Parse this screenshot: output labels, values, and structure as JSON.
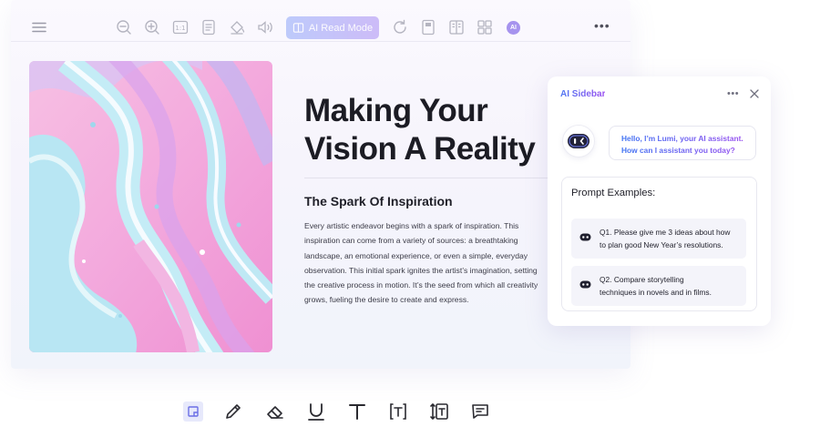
{
  "toolbar": {
    "items": [
      {
        "name": "menu-icon"
      },
      {
        "name": "zoom-out-icon"
      },
      {
        "name": "zoom-in-icon"
      },
      {
        "name": "actual-size-icon",
        "label": "1:1"
      },
      {
        "name": "page-layout-icon"
      },
      {
        "name": "fill-icon"
      },
      {
        "name": "speaker-icon"
      },
      {
        "name": "rotate-icon"
      },
      {
        "name": "single-page-icon"
      },
      {
        "name": "two-page-icon"
      },
      {
        "name": "grid-view-icon"
      },
      {
        "name": "more-icon"
      }
    ],
    "ai_read_mode_label": "AI Read Mode",
    "ai_badge_label": "AI"
  },
  "document": {
    "title_lines": [
      "Making Your",
      "Vision A Reality"
    ],
    "subtitle": "The Spark Of Inspiration",
    "body_lines": [
      "Every artistic endeavor begins with a spark of inspiration. This",
      "inspiration can come from a variety of sources: a breathtaking",
      "landscape, an emotional experience, or even a simple, everyday",
      "observation. This initial spark ignites the artist’s imagination, setting",
      "the creative process in motion. It’s the seed from which all creativity",
      "grows, fueling the desire to create and express."
    ],
    "hero_image": "abstract-pink-blue-fluid-art"
  },
  "ai_sidebar": {
    "title": "AI Sidebar",
    "greeting_lines": [
      "Hello, I’m Lumi, your AI assistant.",
      "How can I assistant you today?"
    ],
    "prompt_examples_title": "Prompt Examples:",
    "prompts": [
      {
        "lines": [
          "Q1. Please give me 3 ideas about how",
          "to plan good New Year’s resolutions."
        ]
      },
      {
        "lines": [
          "Q2. Compare storytelling",
          "techniques in novels and in films."
        ]
      }
    ]
  },
  "bottom_toolbar": {
    "tools": [
      {
        "name": "sticky-note-icon",
        "active": true
      },
      {
        "name": "pencil-icon",
        "active": false
      },
      {
        "name": "eraser-icon",
        "active": false
      },
      {
        "name": "underline-icon",
        "active": false
      },
      {
        "name": "text-icon",
        "active": false
      },
      {
        "name": "text-box-icon",
        "active": false
      },
      {
        "name": "text-callout-icon",
        "active": false
      },
      {
        "name": "comment-icon",
        "active": false
      }
    ]
  },
  "colors": {
    "accent_blue": "#4f77f2",
    "accent_purple": "#9a4ff0",
    "text_dark": "#1c1c24",
    "toolbar_icon": "#b4b4c0",
    "active_tool_bg": "#e7e9fb"
  }
}
